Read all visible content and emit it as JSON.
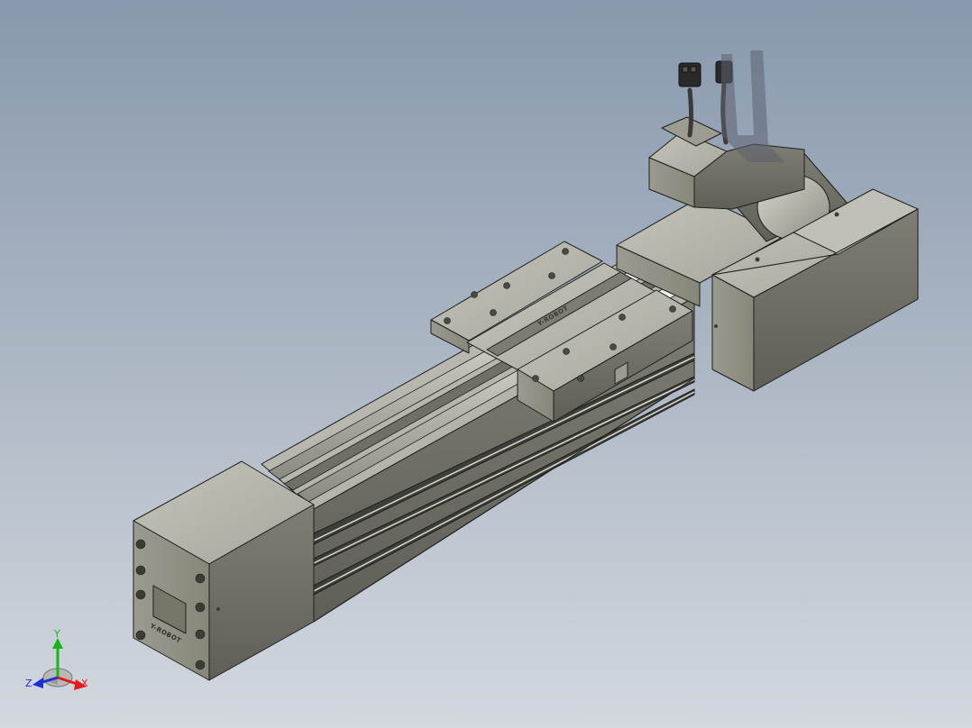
{
  "viewport": {
    "background_top": "#8898ad",
    "background_bottom": "#d3d8df"
  },
  "model": {
    "body_color": "#8e8e84",
    "body_dark": "#6b6b62",
    "body_light": "#b3b3aa",
    "edge_color": "#1e1e1e",
    "carriage_logo_text": "Y-ROBOT",
    "end_cap_logo_text": "Y-ROBOT"
  },
  "triad": {
    "x_label": "X",
    "y_label": "Y",
    "z_label": "Z",
    "x_color": "#e11b1b",
    "y_color": "#18b418",
    "z_color": "#1d2fd6"
  }
}
